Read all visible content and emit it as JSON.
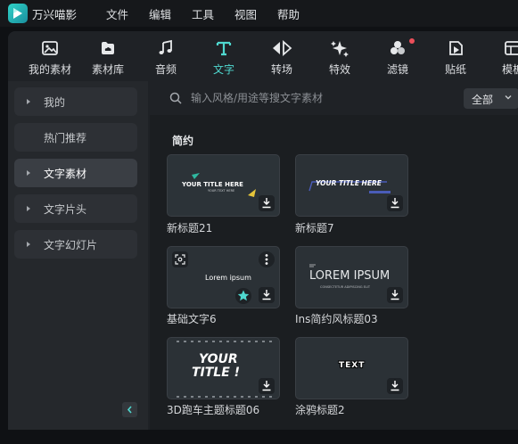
{
  "app": {
    "name": "万兴喵影"
  },
  "menu": [
    "文件",
    "编辑",
    "工具",
    "视图",
    "帮助"
  ],
  "toolbar": {
    "items": [
      {
        "label": "我的素材",
        "icon": "folder-image-icon"
      },
      {
        "label": "素材库",
        "icon": "cloud-library-icon"
      },
      {
        "label": "音频",
        "icon": "music-note-icon"
      },
      {
        "label": "文字",
        "icon": "text-icon",
        "active": true
      },
      {
        "label": "转场",
        "icon": "transition-icon"
      },
      {
        "label": "特效",
        "icon": "sparkle-effects-icon"
      },
      {
        "label": "滤镜",
        "icon": "filter-icon",
        "badge": true
      },
      {
        "label": "贴纸",
        "icon": "sticker-icon"
      },
      {
        "label": "模板",
        "icon": "template-icon"
      }
    ]
  },
  "sidebar": {
    "items": [
      {
        "label": "我的",
        "arrow": true
      },
      {
        "label": "热门推荐",
        "arrow": false
      },
      {
        "label": "文字素材",
        "arrow": true,
        "active": true
      },
      {
        "label": "文字片头",
        "arrow": true
      },
      {
        "label": "文字幻灯片",
        "arrow": true
      }
    ]
  },
  "search": {
    "placeholder": "输入风格/用途等搜文字素材",
    "value": ""
  },
  "filter": {
    "selected": "全部"
  },
  "section": {
    "title": "简约"
  },
  "cards": [
    {
      "label": "新标题21",
      "preview_text": "YOUR TITLE HERE",
      "preview_sub": "YOUR TEXT HERE"
    },
    {
      "label": "新标题7",
      "preview_text": "YOUR TITLE HERE"
    },
    {
      "label": "基础文字6",
      "preview_text": "Lorem ipsum"
    },
    {
      "label": "Ins简约风标题03",
      "preview_text": "LOREM IPSUM",
      "preview_sub": "CONSECTETUR ADIPISCING ELIT"
    },
    {
      "label": "3D跑车主题标题06",
      "preview_text": "YOUR",
      "preview_text2": "TITLE !"
    },
    {
      "label": "涂鸦标题2",
      "preview_text": "TEXT"
    }
  ],
  "colors": {
    "accent": "#4fd8cf",
    "badge": "#ec4f5a",
    "background": "#1b1e21"
  }
}
